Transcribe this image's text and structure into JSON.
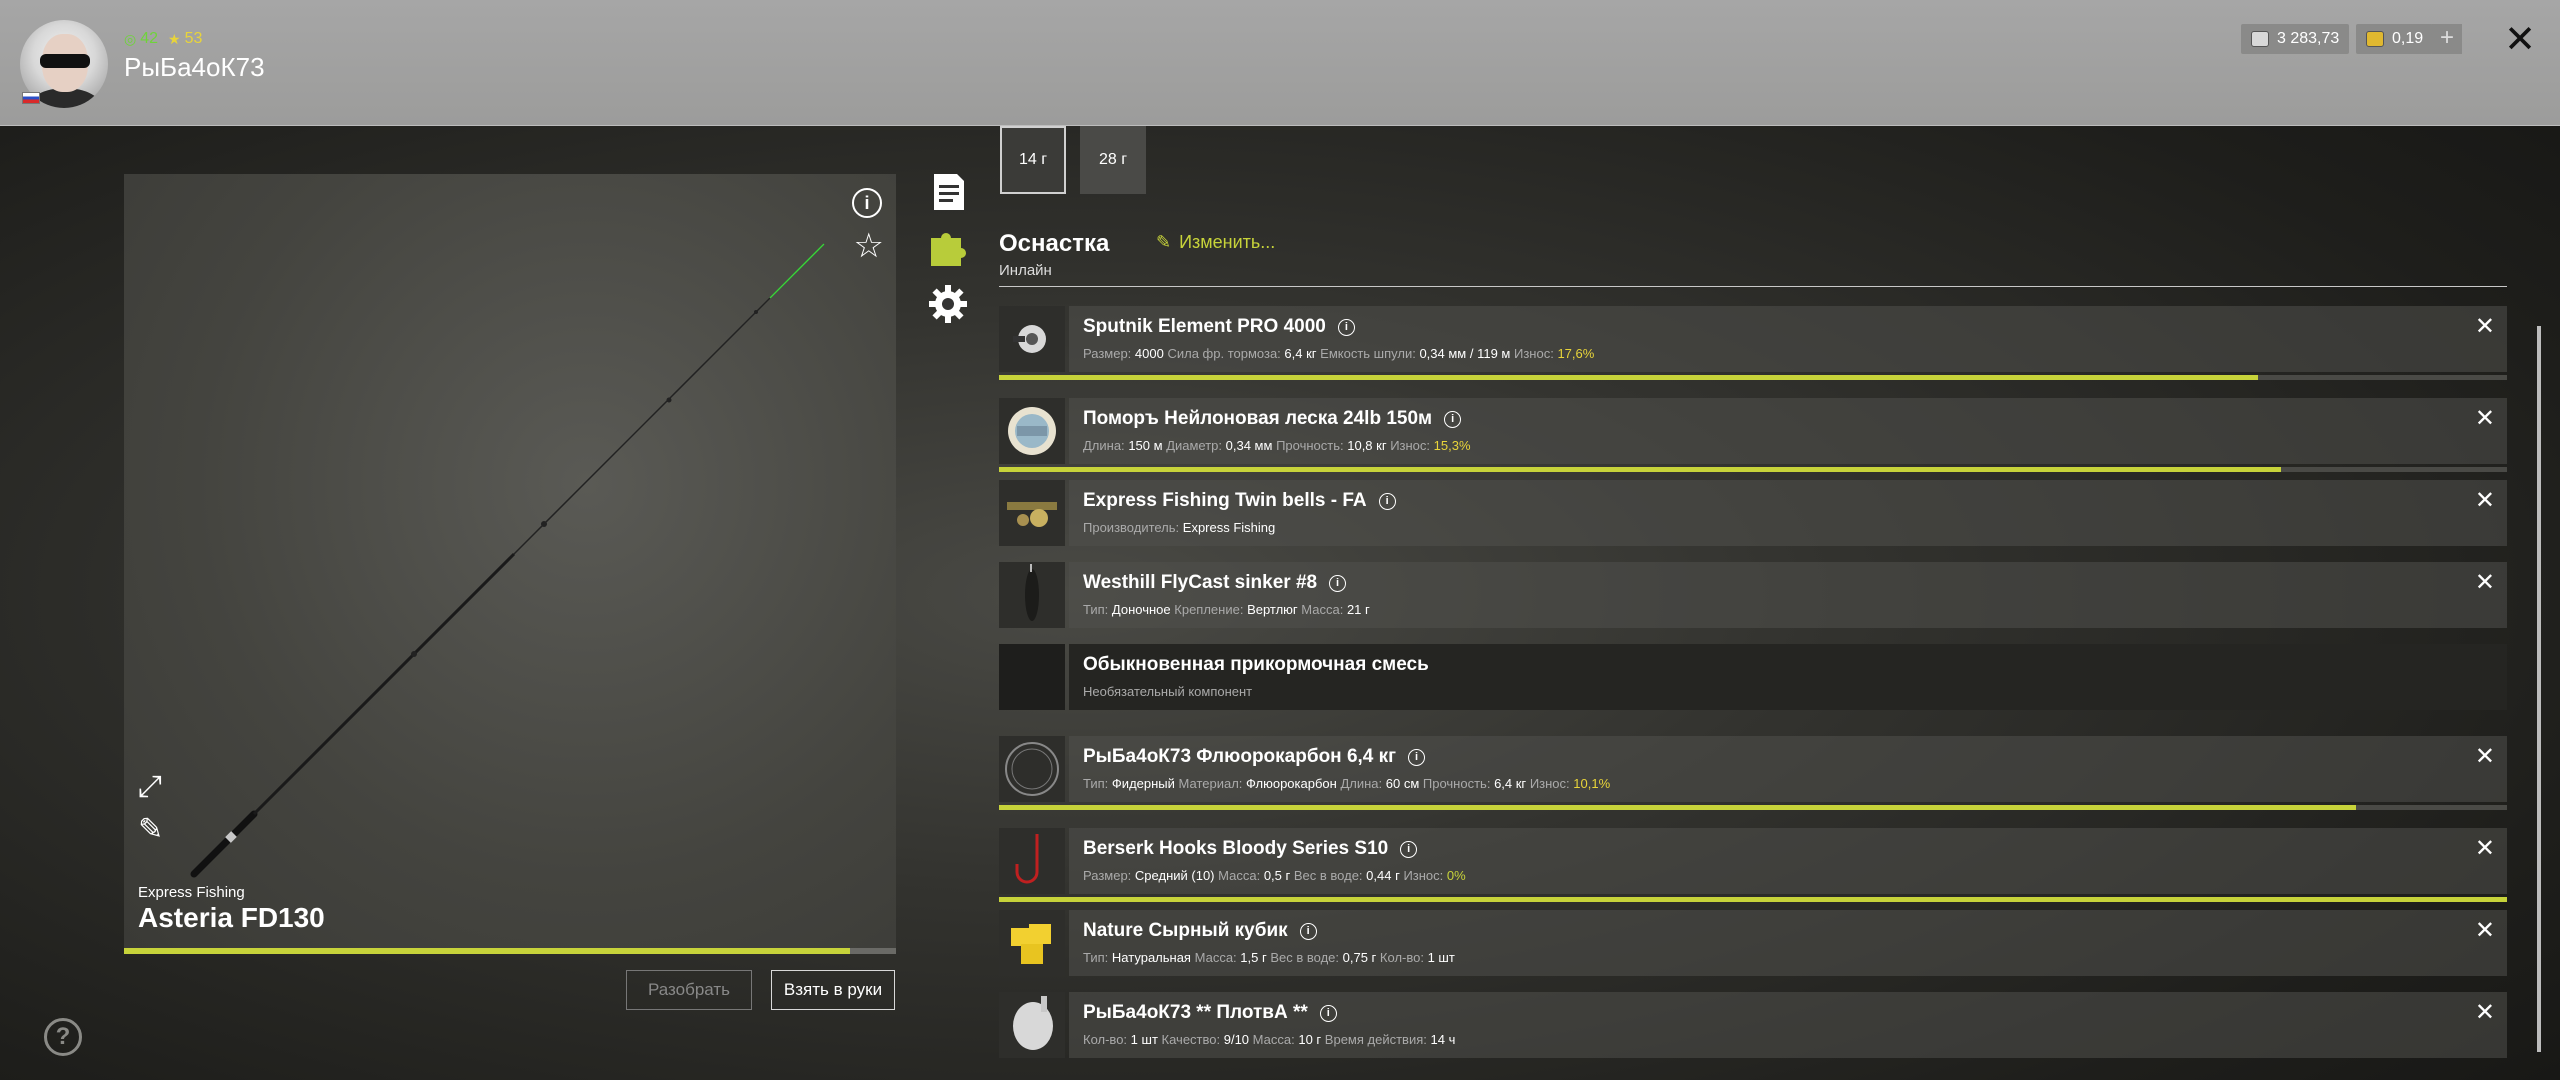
{
  "player": {
    "name": "РыБа4оК73",
    "level": "42",
    "rank": "53",
    "silver": "3 283,73",
    "gold": "0,19"
  },
  "rod": {
    "brand": "Express Fishing",
    "name": "Asteria FD130",
    "durability": 0.94,
    "disassemble_label": "Разобрать",
    "take_label": "Взять в руки"
  },
  "weights": [
    {
      "label": "14 г",
      "active": true
    },
    {
      "label": "28 г",
      "active": false
    }
  ],
  "tackle": {
    "title": "Оснастка",
    "subtitle": "Инлайн",
    "change_label": "Изменить..."
  },
  "items": [
    {
      "name": "Sputnik Element PRO 4000",
      "props": [
        {
          "k": "Размер:",
          "v": "4000"
        },
        {
          "k": "Сила фр. тормоза:",
          "v": "6,4 кг"
        },
        {
          "k": "Емкость шпули:",
          "v": "0,34 мм / 119 м"
        },
        {
          "k": "Износ:",
          "v": "17,6%",
          "w": true
        }
      ],
      "durability": 0.835
    },
    {
      "name": "Поморъ Нейлоновая леска 24lb 150м",
      "props": [
        {
          "k": "Длина:",
          "v": "150 м"
        },
        {
          "k": "Диаметр:",
          "v": "0,34 мм"
        },
        {
          "k": "Прочность:",
          "v": "10,8 кг"
        },
        {
          "k": "Износ:",
          "v": "15,3%",
          "w": true
        }
      ],
      "durability": 0.85
    },
    {
      "name": "Express Fishing Twin bells - FA",
      "props": [
        {
          "k": "Производитель:",
          "v": "Express Fishing"
        }
      ]
    },
    {
      "name": "Westhill FlyCast sinker #8",
      "props": [
        {
          "k": "Тип:",
          "v": "Доночное"
        },
        {
          "k": "Крепление:",
          "v": "Вертлюг"
        },
        {
          "k": "Масса:",
          "v": "21 г"
        }
      ]
    },
    {
      "name": "Обыкновенная прикормочная смесь",
      "props": [
        {
          "k": "Необязательный компонент",
          "v": ""
        }
      ]
    },
    {
      "name": "РыБа4оК73 Флюорокарбон 6,4 кг",
      "props": [
        {
          "k": "Тип:",
          "v": "Фидерный"
        },
        {
          "k": "Материал:",
          "v": "Флюорокарбон"
        },
        {
          "k": "Длина:",
          "v": "60 см"
        },
        {
          "k": "Прочность:",
          "v": "6,4 кг"
        },
        {
          "k": "Износ:",
          "v": "10,1%",
          "w": true
        }
      ],
      "durability": 0.9
    },
    {
      "name": "Berserk Hooks Bloody Series S10",
      "props": [
        {
          "k": "Размер:",
          "v": "Средний (10)"
        },
        {
          "k": "Масса:",
          "v": "0,5 г"
        },
        {
          "k": "Вес в воде:",
          "v": "0,44 г"
        },
        {
          "k": "Износ:",
          "v": "0%",
          "wg": true
        }
      ],
      "durability": 1.0
    },
    {
      "name": "Nature Сырный кубик",
      "props": [
        {
          "k": "Тип:",
          "v": "Натуральная"
        },
        {
          "k": "Масса:",
          "v": "1,5 г"
        },
        {
          "k": "Вес в воде:",
          "v": "0,75 г"
        },
        {
          "k": "Кол-во:",
          "v": "1 шт"
        }
      ]
    },
    {
      "name": "РыБа4оК73 ** ПлотвА **",
      "props": [
        {
          "k": "Кол-во:",
          "v": "1 шт"
        },
        {
          "k": "Качество:",
          "v": "9/10"
        },
        {
          "k": "Масса:",
          "v": "10 г"
        },
        {
          "k": "Время действия:",
          "v": "14 ч"
        }
      ]
    }
  ]
}
